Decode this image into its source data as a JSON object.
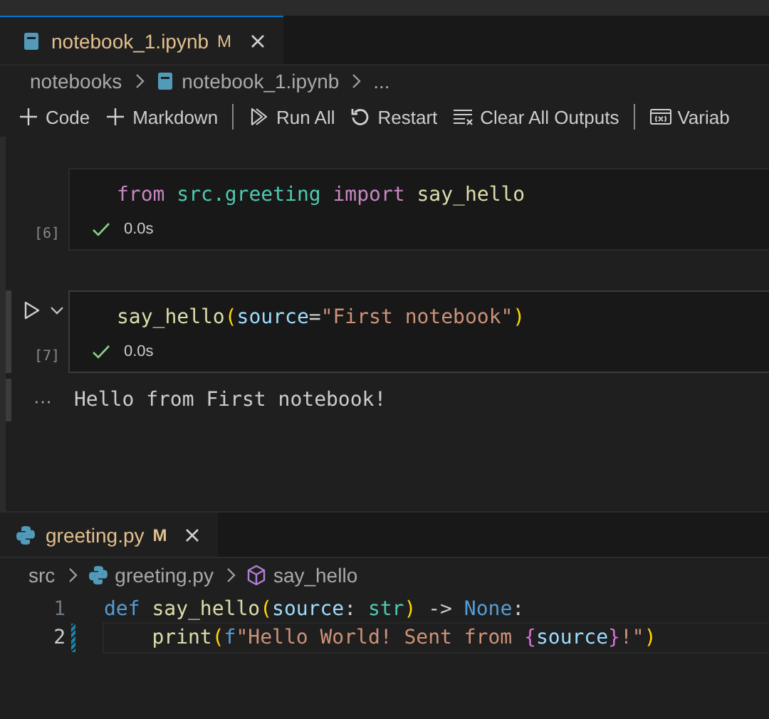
{
  "notebook_editor": {
    "tab": {
      "label": "notebook_1.ipynb",
      "badge": "M",
      "selected": true
    },
    "breadcrumbs": [
      {
        "label": "notebooks",
        "kind": "folder"
      },
      {
        "label": "notebook_1.ipynb",
        "kind": "notebook"
      },
      {
        "label": "...",
        "kind": "overflow"
      }
    ],
    "toolbar": [
      {
        "kind": "add",
        "label": "Code"
      },
      {
        "kind": "add",
        "label": "Markdown"
      },
      {
        "kind": "separator"
      },
      {
        "kind": "run",
        "label": "Run All"
      },
      {
        "kind": "restart",
        "label": "Restart"
      },
      {
        "kind": "clear",
        "label": "Clear All Outputs"
      },
      {
        "kind": "separator"
      },
      {
        "kind": "variables",
        "label": "Variab"
      }
    ],
    "cells": [
      {
        "count": "[6]",
        "succeeded": true,
        "time": "0.0s",
        "focused": false,
        "tokens": [
          {
            "kind": "keyword",
            "text": "from "
          },
          {
            "kind": "module",
            "text": "src.greeting"
          },
          {
            "kind": "keyword",
            "text": " import "
          },
          {
            "kind": "function",
            "text": "say_hello"
          }
        ]
      },
      {
        "count": "[7]",
        "succeeded": true,
        "time": "0.0s",
        "focused": true,
        "output_menu": "···",
        "tokens": [
          {
            "kind": "function",
            "text": "say_hello"
          },
          {
            "kind": "bracket",
            "text": "("
          },
          {
            "kind": "param",
            "text": "source"
          },
          {
            "kind": "plain",
            "text": "="
          },
          {
            "kind": "string",
            "text": "\"First notebook\""
          },
          {
            "kind": "bracket",
            "text": ")"
          }
        ],
        "output": [
          "Hello from First notebook!"
        ]
      }
    ]
  },
  "code_editor": {
    "tab": {
      "label": "greeting.py",
      "badge": "M",
      "selected": true
    },
    "breadcrumbs": [
      {
        "label": "src",
        "kind": "folder"
      },
      {
        "label": "greeting.py",
        "kind": "python"
      },
      {
        "label": "say_hello",
        "kind": "method"
      }
    ],
    "lines": [
      {
        "number": "1",
        "modified": false,
        "current": false,
        "tokens": [
          {
            "kind": "storage",
            "text": "def "
          },
          {
            "kind": "function",
            "text": "say_hello"
          },
          {
            "kind": "bracket",
            "text": "("
          },
          {
            "kind": "param",
            "text": "source"
          },
          {
            "kind": "plain",
            "text": ": "
          },
          {
            "kind": "module",
            "text": "str"
          },
          {
            "kind": "bracket",
            "text": ")"
          },
          {
            "kind": "plain",
            "text": " -> "
          },
          {
            "kind": "storage",
            "text": "None"
          },
          {
            "kind": "plain",
            "text": ":"
          }
        ]
      },
      {
        "number": "2",
        "modified": true,
        "current": true,
        "tokens": [
          {
            "kind": "function",
            "text": "    print"
          },
          {
            "kind": "bracket",
            "text": "("
          },
          {
            "kind": "storage",
            "text": "f"
          },
          {
            "kind": "string",
            "text": "\"Hello World! Sent from "
          },
          {
            "kind": "bracket2",
            "text": "{"
          },
          {
            "kind": "param",
            "text": "source"
          },
          {
            "kind": "bracket2",
            "text": "}"
          },
          {
            "kind": "string",
            "text": "!\""
          },
          {
            "kind": "bracket",
            "text": ")"
          }
        ]
      }
    ]
  }
}
